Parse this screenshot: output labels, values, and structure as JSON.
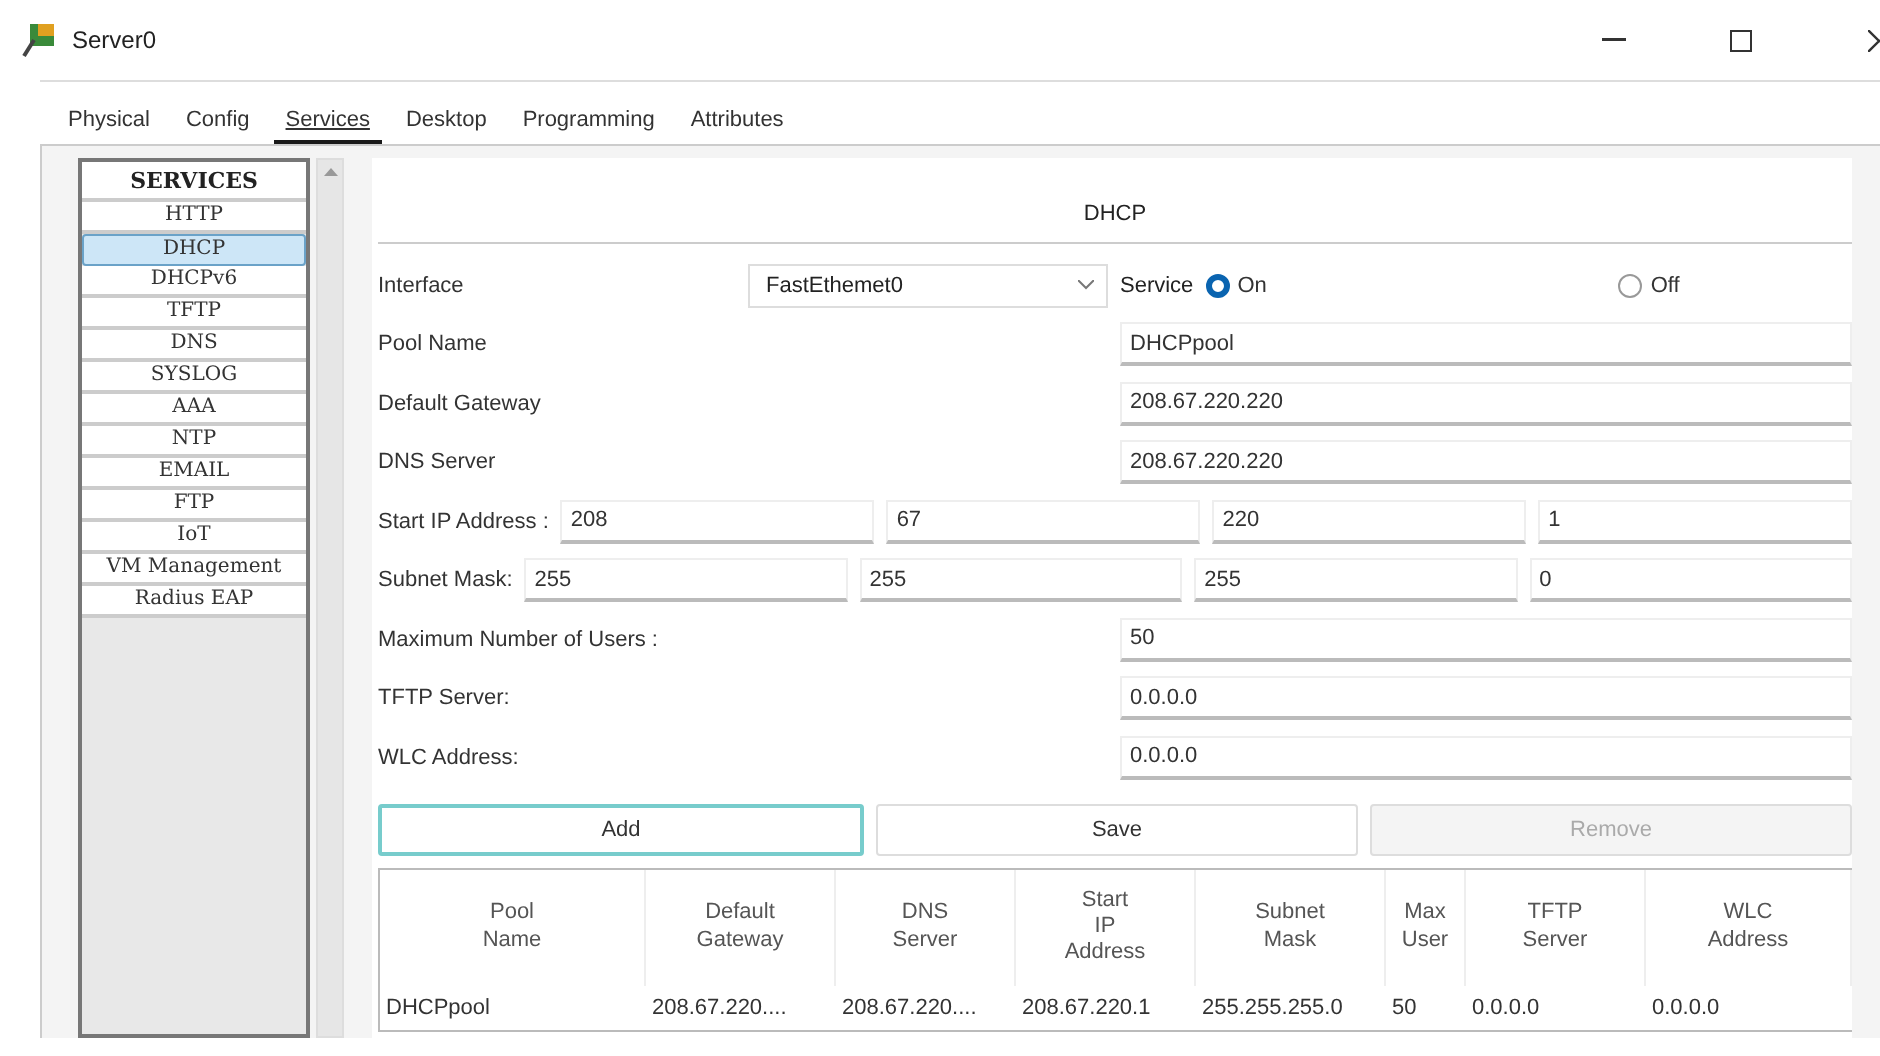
{
  "window": {
    "title": "Server0"
  },
  "tabs": [
    {
      "label": "Physical",
      "selected": false
    },
    {
      "label": "Config",
      "selected": false
    },
    {
      "label": "Services",
      "selected": true
    },
    {
      "label": "Desktop",
      "selected": false
    },
    {
      "label": "Programming",
      "selected": false
    },
    {
      "label": "Attributes",
      "selected": false
    }
  ],
  "sidebar": {
    "heading": "SERVICES",
    "items": [
      {
        "label": "HTTP",
        "selected": false
      },
      {
        "label": "DHCP",
        "selected": true
      },
      {
        "label": "DHCPv6",
        "selected": false
      },
      {
        "label": "TFTP",
        "selected": false
      },
      {
        "label": "DNS",
        "selected": false
      },
      {
        "label": "SYSLOG",
        "selected": false
      },
      {
        "label": "AAA",
        "selected": false
      },
      {
        "label": "NTP",
        "selected": false
      },
      {
        "label": "EMAIL",
        "selected": false
      },
      {
        "label": "FTP",
        "selected": false
      },
      {
        "label": "IoT",
        "selected": false
      },
      {
        "label": "VM Management",
        "selected": false
      },
      {
        "label": "Radius EAP",
        "selected": false
      }
    ]
  },
  "dhcp": {
    "title": "DHCP",
    "interface": {
      "label": "Interface",
      "value": "FastEthemet0"
    },
    "service": {
      "label": "Service",
      "options": [
        {
          "label": "On",
          "selected": true
        },
        {
          "label": "Off",
          "selected": false
        }
      ]
    },
    "fields": [
      {
        "kind": "single",
        "label": "Pool Name",
        "value": "DHCPpool"
      },
      {
        "kind": "single",
        "label": "Default Gateway",
        "value": "208.67.220.220"
      },
      {
        "kind": "single",
        "label": "DNS Server",
        "value": "208.67.220.220"
      },
      {
        "kind": "octets",
        "label": "Start IP Address :",
        "values": [
          "208",
          "67",
          "220",
          "1"
        ]
      },
      {
        "kind": "octets",
        "label": "Subnet Mask:",
        "values": [
          "255",
          "255",
          "255",
          "0"
        ]
      },
      {
        "kind": "single",
        "label": "Maximum Number of Users :",
        "value": "50"
      },
      {
        "kind": "single",
        "label": "TFTP Server:",
        "value": "0.0.0.0"
      },
      {
        "kind": "single",
        "label": "WLC Address:",
        "value": "0.0.0.0"
      }
    ],
    "buttons": [
      {
        "label": "Add",
        "focused": true,
        "disabled": false
      },
      {
        "label": "Save",
        "focused": false,
        "disabled": false
      },
      {
        "label": "Remove",
        "focused": false,
        "disabled": true
      }
    ],
    "table": {
      "columns": [
        "Pool\nName",
        "Default\nGateway",
        "DNS\nServer",
        "Start\nIP\nAddress",
        "Subnet\nMask",
        "Max\nUser",
        "TFTP\nServer",
        "WLC\nAddress"
      ],
      "rows": [
        [
          "DHCPpool",
          "208.67.220....",
          "208.67.220....",
          "208.67.220.1",
          "255.255.255.0",
          "50",
          "0.0.0.0",
          "0.0.0.0"
        ]
      ]
    }
  }
}
